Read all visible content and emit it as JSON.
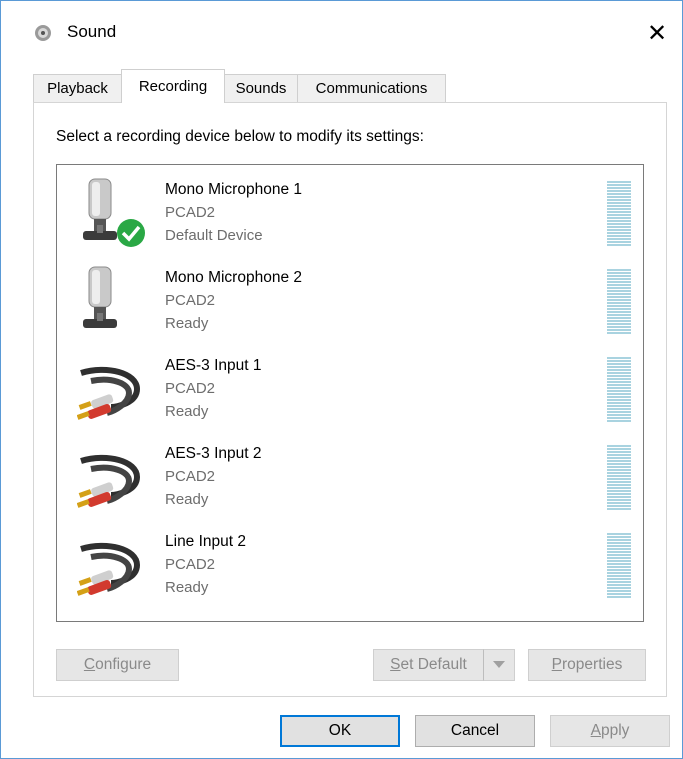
{
  "window": {
    "title": "Sound",
    "close_glyph": "✕",
    "title_icon": "speaker-icon"
  },
  "tabs": [
    {
      "label": "Playback"
    },
    {
      "label": "Recording"
    },
    {
      "label": "Sounds"
    },
    {
      "label": "Communications"
    }
  ],
  "active_tab": "Recording",
  "instruction": "Select a recording device below to modify its settings:",
  "devices": [
    {
      "name": "Mono Microphone 1",
      "driver": "PCAD2",
      "status": "Default Device",
      "icon": "microphone-icon",
      "default": true
    },
    {
      "name": "Mono Microphone 2",
      "driver": "PCAD2",
      "status": "Ready",
      "icon": "microphone-icon",
      "default": false
    },
    {
      "name": "AES-3 Input 1",
      "driver": "PCAD2",
      "status": "Ready",
      "icon": "rca-cable-icon",
      "default": false
    },
    {
      "name": "AES-3 Input 2",
      "driver": "PCAD2",
      "status": "Ready",
      "icon": "rca-cable-icon",
      "default": false
    },
    {
      "name": "Line Input 2",
      "driver": "PCAD2",
      "status": "Ready",
      "icon": "rca-cable-icon",
      "default": false
    }
  ],
  "panel_buttons": {
    "configure": {
      "accel": "C",
      "rest": "onfigure"
    },
    "set_default": {
      "accel": "S",
      "rest": "et Default"
    },
    "properties": {
      "accel": "P",
      "rest": "roperties"
    }
  },
  "dialog_buttons": {
    "ok": "OK",
    "cancel": "Cancel",
    "apply": {
      "accel": "A",
      "rest": "pply"
    }
  },
  "colors": {
    "accent": "#0078d7",
    "meter": "#a9d3e0",
    "default_check": "#2aa845"
  }
}
